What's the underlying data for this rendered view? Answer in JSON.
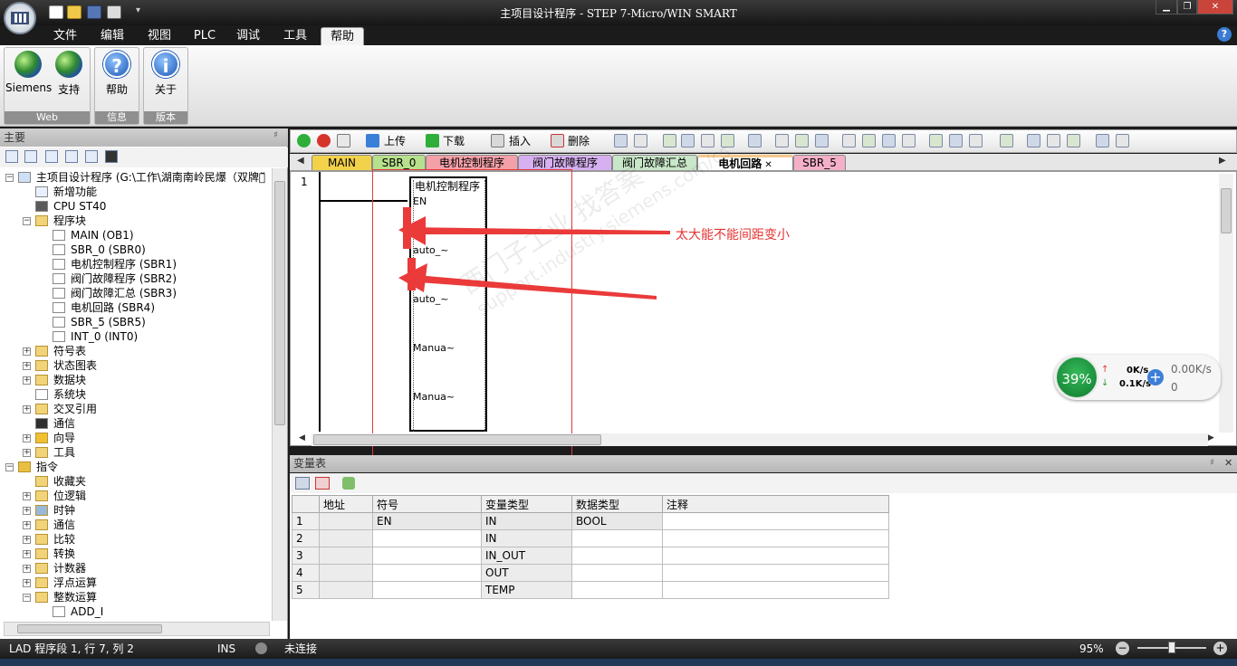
{
  "window": {
    "title": "主项目设计程序 - STEP 7-Micro/WIN SMART"
  },
  "menu": [
    "文件",
    "编辑",
    "视图",
    "PLC",
    "调试",
    "工具",
    "帮助"
  ],
  "ribbon": {
    "groups": [
      {
        "label": "Web",
        "buttons": [
          "Siemens",
          "支持"
        ]
      },
      {
        "label": "信息",
        "buttons": [
          "帮助"
        ]
      },
      {
        "label": "版本",
        "buttons": [
          "关于"
        ]
      }
    ]
  },
  "left_panel": {
    "title": "主要",
    "tree": [
      {
        "label": "主项目设计程序 (G:\\工作\\湖南南岭民爆（双牌一̆",
        "level": 0,
        "expander": "-",
        "icon": "project-icon"
      },
      {
        "label": "新增功能",
        "level": 1,
        "icon": "help-icon"
      },
      {
        "label": "CPU ST40",
        "level": 1,
        "icon": "cpu-icon"
      },
      {
        "label": "程序块",
        "level": 1,
        "expander": "-",
        "icon": "folder-icon"
      },
      {
        "label": "MAIN (OB1)",
        "level": 2,
        "icon": "page-icon"
      },
      {
        "label": "SBR_0 (SBR0)",
        "level": 2,
        "icon": "page-icon"
      },
      {
        "label": "电机控制程序 (SBR1)",
        "level": 2,
        "icon": "page-icon"
      },
      {
        "label": "阀门故障程序 (SBR2)",
        "level": 2,
        "icon": "page-icon"
      },
      {
        "label": "阀门故障汇总 (SBR3)",
        "level": 2,
        "icon": "page-icon"
      },
      {
        "label": "电机回路 (SBR4)",
        "level": 2,
        "icon": "page-icon"
      },
      {
        "label": "SBR_5 (SBR5)",
        "level": 2,
        "icon": "page-icon"
      },
      {
        "label": "INT_0 (INT0)",
        "level": 2,
        "icon": "page-icon"
      },
      {
        "label": "符号表",
        "level": 1,
        "expander": "+",
        "icon": "folder-icon"
      },
      {
        "label": "状态图表",
        "level": 1,
        "expander": "+",
        "icon": "folder-icon"
      },
      {
        "label": "数据块",
        "level": 1,
        "expander": "+",
        "icon": "folder-icon"
      },
      {
        "label": "系统块",
        "level": 1,
        "icon": "page-icon"
      },
      {
        "label": "交叉引用",
        "level": 1,
        "expander": "+",
        "icon": "folder-icon"
      },
      {
        "label": "通信",
        "level": 1,
        "icon": "monitor-icon"
      },
      {
        "label": "向导",
        "level": 1,
        "expander": "+",
        "icon": "wizard-icon"
      },
      {
        "label": "工具",
        "level": 1,
        "expander": "+",
        "icon": "folder-icon"
      },
      {
        "label": "指令",
        "level": 0,
        "expander": "-",
        "icon": "instruction-icon"
      },
      {
        "label": "收藏夹",
        "level": 1,
        "icon": "folder-icon"
      },
      {
        "label": "位逻辑",
        "level": 1,
        "expander": "+",
        "icon": "folder-icon"
      },
      {
        "label": "时钟",
        "level": 1,
        "expander": "+",
        "icon": "clock-icon"
      },
      {
        "label": "通信",
        "level": 1,
        "expander": "+",
        "icon": "folder-icon"
      },
      {
        "label": "比较",
        "level": 1,
        "expander": "+",
        "icon": "folder-icon"
      },
      {
        "label": "转换",
        "level": 1,
        "expander": "+",
        "icon": "folder-icon"
      },
      {
        "label": "计数器",
        "level": 1,
        "expander": "+",
        "icon": "folder-icon"
      },
      {
        "label": "浮点运算",
        "level": 1,
        "expander": "+",
        "icon": "folder-icon"
      },
      {
        "label": "整数运算",
        "level": 1,
        "expander": "-",
        "icon": "folder-icon"
      },
      {
        "label": "ADD_I",
        "level": 2,
        "icon": "page-icon"
      }
    ]
  },
  "editor_toolbar": {
    "upload": "上传",
    "download": "下载",
    "insert": "插入",
    "delete": "删除"
  },
  "tabs": [
    "MAIN",
    "SBR_0",
    "电机控制程序",
    "阀门故障程序",
    "阀门故障汇总",
    "电机回路",
    "SBR_5"
  ],
  "active_tab": "电机回路",
  "tab_colors": [
    "#f2d24a",
    "#b7e08c",
    "#f4a0a8",
    "#d6b0f0",
    "#c8e6c8",
    "#f6c98e",
    "#f4b0c8"
  ],
  "ladder": {
    "network_number": "1",
    "block_title": "电机控制程序",
    "pins": [
      "EN",
      "auto_~",
      "auto_~",
      "Manua~",
      "Manua~"
    ]
  },
  "annotation": {
    "text": "太大能不能间距变小"
  },
  "watermark": {
    "line1": "西门子工业  找答案",
    "line2": "support.industry.siemens.com/cs"
  },
  "net_widget": {
    "percent": "39%",
    "up": "0K/s",
    "down": "0.1K/s",
    "speed": "0.00K/s",
    "count": "0"
  },
  "var_table": {
    "title": "变量表",
    "columns": [
      "",
      "地址",
      "符号",
      "变量类型",
      "数据类型",
      "注释"
    ],
    "rows": [
      [
        "1",
        "",
        "EN",
        "IN",
        "BOOL",
        ""
      ],
      [
        "2",
        "",
        "",
        "IN",
        "",
        ""
      ],
      [
        "3",
        "",
        "",
        "IN_OUT",
        "",
        ""
      ],
      [
        "4",
        "",
        "",
        "OUT",
        "",
        ""
      ],
      [
        "5",
        "",
        "",
        "TEMP",
        "",
        ""
      ]
    ]
  },
  "status": {
    "position": "LAD 程序段 1, 行 7, 列 2",
    "mode": "INS",
    "connection": "未连接",
    "zoom": "95%"
  }
}
